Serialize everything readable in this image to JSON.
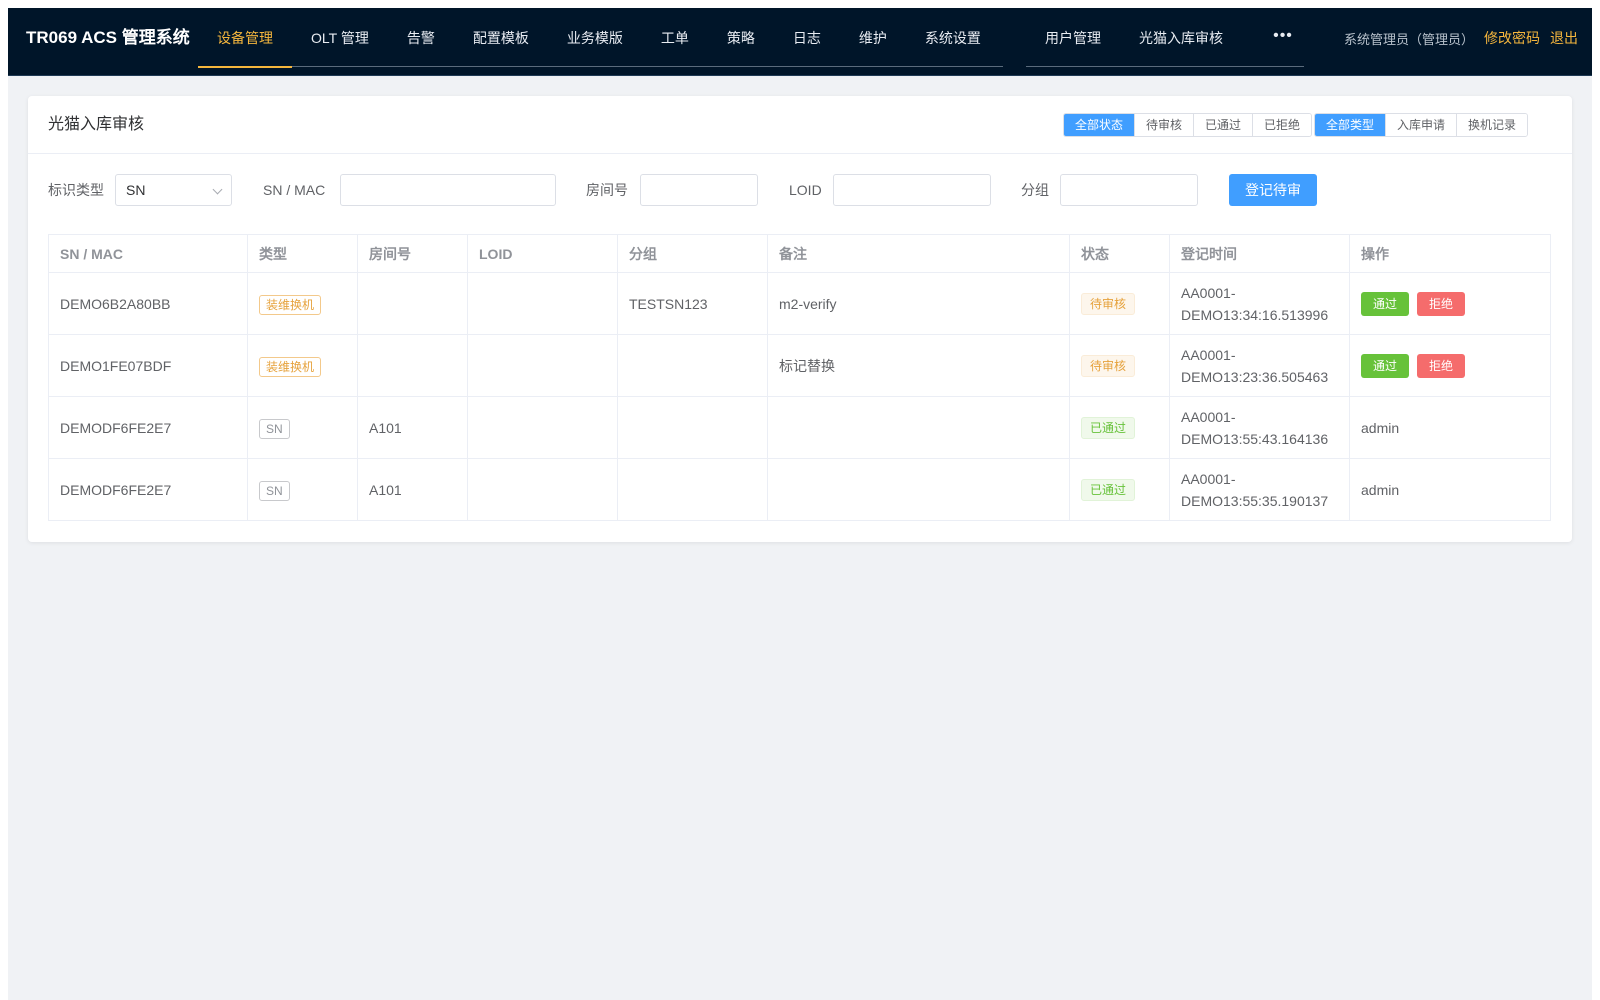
{
  "app": {
    "title": "TR069 ACS 管理系统",
    "nav": [
      "设备管理",
      "OLT 管理",
      "告警",
      "配置模板",
      "业务模版",
      "工单",
      "策略",
      "日志",
      "维护",
      "系统设置"
    ],
    "nav2": [
      "用户管理",
      "光猫入库审核"
    ],
    "active_nav": "设备管理",
    "more": "•••",
    "user": "系统管理员（管理员）",
    "change_password": "修改密码",
    "logout": "退出"
  },
  "page": {
    "title": "光猫入库审核",
    "status_filters": [
      "全部状态",
      "待审核",
      "已通过",
      "已拒绝"
    ],
    "active_status": "全部状态",
    "type_filters": [
      "全部类型",
      "入库申请",
      "换机记录"
    ],
    "active_type": "全部类型"
  },
  "form": {
    "id_type_label": "标识类型",
    "id_type_value": "SN",
    "sn_label": "SN / MAC",
    "sn_value": "",
    "room_label": "房间号",
    "room_value": "",
    "loid_label": "LOID",
    "loid_value": "",
    "group_label": "分组",
    "group_value": "",
    "submit": "登记待审"
  },
  "table": {
    "columns": [
      "SN / MAC",
      "类型",
      "房间号",
      "LOID",
      "分组",
      "备注",
      "状态",
      "登记时间",
      "操作"
    ],
    "rows": [
      {
        "sn": "DEMO6B2A80BB",
        "type": "装维换机",
        "room": "",
        "loid": "",
        "group": "TESTSN123",
        "note": "m2-verify",
        "status": "待审核",
        "time1": "AA0001-",
        "time2": "DEMO13:34:16.513996",
        "approve": "通过",
        "reject": "拒绝"
      },
      {
        "sn": "DEMO1FE07BDF",
        "type": "装维换机",
        "room": "",
        "loid": "",
        "group": "",
        "note": "标记替换",
        "status": "待审核",
        "time1": "AA0001-",
        "time2": "DEMO13:23:36.505463",
        "approve": "通过",
        "reject": "拒绝"
      },
      {
        "sn": "DEMODF6FE2E7",
        "type": "SN",
        "room": "A101",
        "loid": "",
        "group": "",
        "note": "",
        "status": "已通过",
        "time1": "AA0001-",
        "time2": "DEMO13:55:43.164136",
        "operator": "admin"
      },
      {
        "sn": "DEMODF6FE2E7",
        "type": "SN",
        "room": "A101",
        "loid": "",
        "group": "",
        "note": "",
        "status": "已通过",
        "time1": "AA0001-",
        "time2": "DEMO13:55:35.190137",
        "operator": "admin"
      }
    ]
  },
  "colors": {
    "topbar": "#001529",
    "accent": "#f5b63d",
    "primary": "#409eff",
    "success": "#67c23a",
    "danger": "#f56c6c",
    "warning": "#e6a23c"
  }
}
